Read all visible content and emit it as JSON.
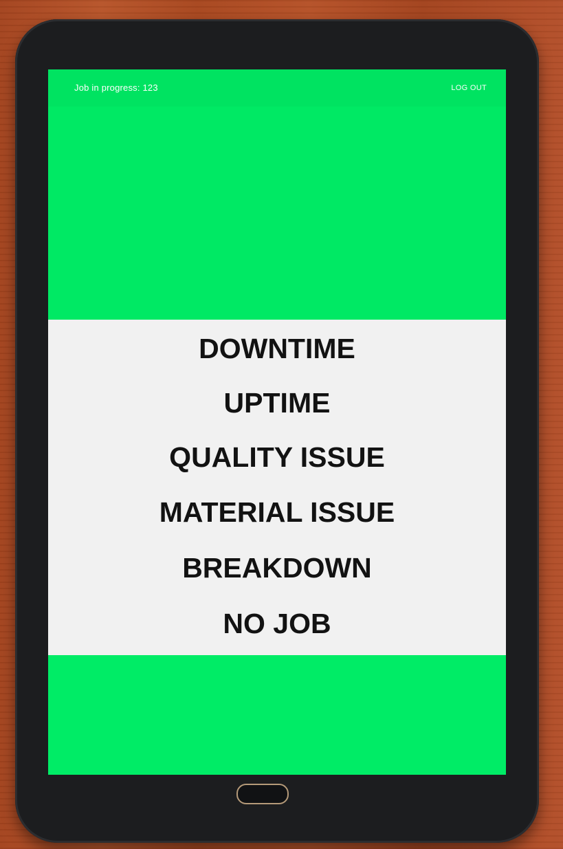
{
  "toolbar": {
    "job_status": "Job in progress: 123",
    "logout_label": "LOG OUT"
  },
  "menu": {
    "items": [
      {
        "label": "DOWNTIME"
      },
      {
        "label": "UPTIME"
      },
      {
        "label": "QUALITY ISSUE"
      },
      {
        "label": "MATERIAL ISSUE"
      },
      {
        "label": "BREAKDOWN"
      },
      {
        "label": "NO JOB"
      }
    ]
  },
  "colors": {
    "status_green": "#00e964",
    "menu_background": "#f1f1f1",
    "menu_text": "#121212",
    "toolbar_text": "#ffffff"
  },
  "icons": {
    "home_button": "home-button-icon"
  }
}
